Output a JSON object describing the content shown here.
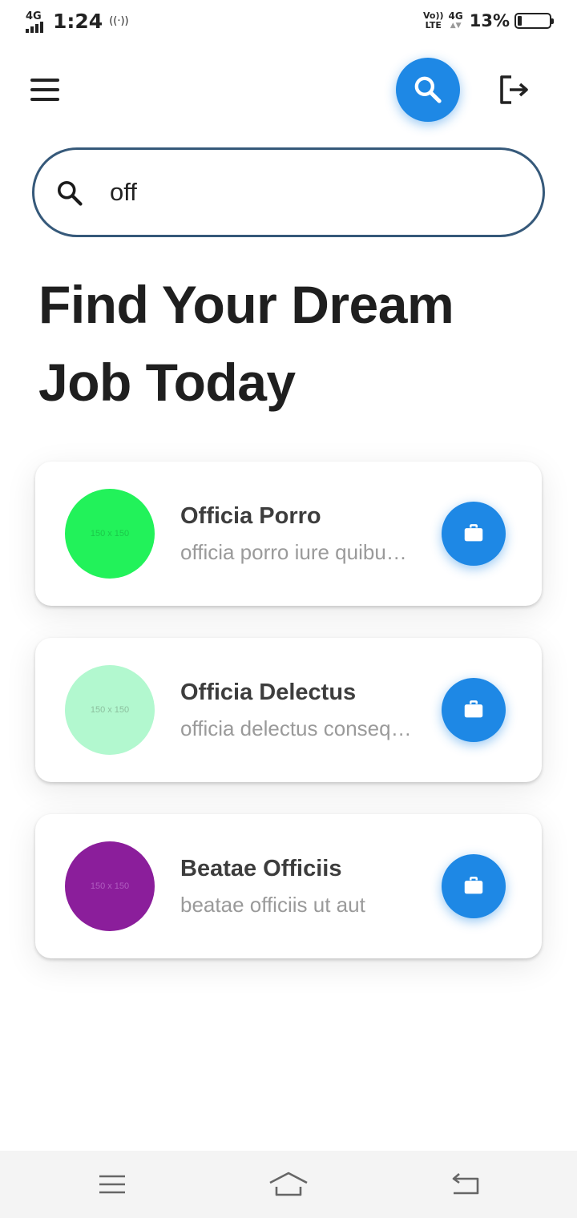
{
  "status_bar": {
    "network": "4G",
    "time": "1:24",
    "hotspot": "((·))",
    "volte_top": "Vo))",
    "volte_bottom": "LTE",
    "data_type": "4G",
    "data_arrows": "▲▼",
    "battery_percent": "13%",
    "battery_level": 0.13
  },
  "app_bar": {
    "menu_icon": "hamburger-icon",
    "search_icon": "search-icon",
    "logout_icon": "logout-icon"
  },
  "search": {
    "value": "off",
    "placeholder": ""
  },
  "headline": "Find Your Dream Job Today",
  "colors": {
    "accent": "#1e88e5",
    "search_border": "#36597a"
  },
  "jobs": [
    {
      "title": "Officia Porro",
      "subtitle": "officia porro iure quibusdam",
      "avatar_text": "150 x 150",
      "avatar_color": "#22f25a",
      "avatar_text_color": "#1cc84a",
      "action_icon": "briefcase-icon"
    },
    {
      "title": "Officia Delectus",
      "subtitle": "officia delectus consequatur",
      "avatar_text": "150 x 150",
      "avatar_color": "#b2f8cf",
      "avatar_text_color": "#8cbf9e",
      "action_icon": "briefcase-icon"
    },
    {
      "title": "Beatae Officiis",
      "subtitle": "beatae officiis ut aut",
      "avatar_text": "150 x 150",
      "avatar_color": "#8b1e9b",
      "avatar_text_color": "#b05cc0",
      "action_icon": "briefcase-icon"
    }
  ],
  "nav_bar": {
    "recents_icon": "recents-icon",
    "home_icon": "home-icon",
    "back_icon": "back-icon"
  }
}
